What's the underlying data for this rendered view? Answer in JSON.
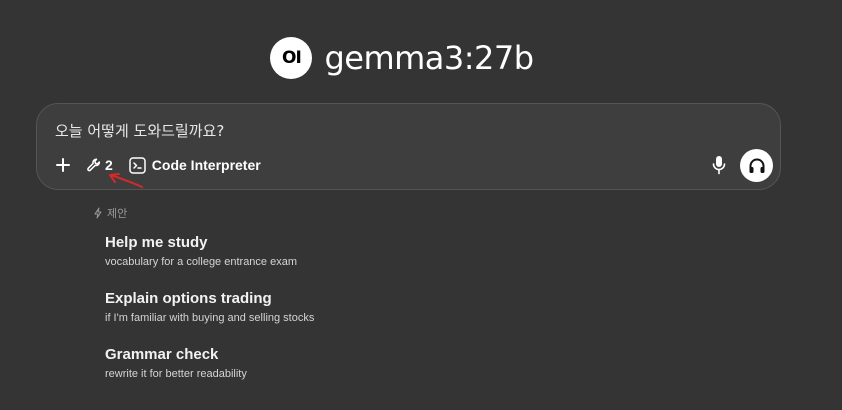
{
  "header": {
    "logo_text": "OI",
    "model_name": "gemma3:27b"
  },
  "chat": {
    "placeholder": "오늘 어떻게 도와드릴까요?",
    "plus_icon": "plus-icon",
    "tools_icon": "wrench-icon",
    "tools_count": "2",
    "code_icon": "terminal-icon",
    "code_label": "Code Interpreter",
    "mic_icon": "microphone-icon",
    "voice_icon": "headphones-icon"
  },
  "annotation": {
    "color": "#d42a2a"
  },
  "suggestions": {
    "icon": "bolt-icon",
    "label": "제안",
    "items": [
      {
        "title": "Help me study",
        "subtitle": "vocabulary for a college entrance exam"
      },
      {
        "title": "Explain options trading",
        "subtitle": "if I'm familiar with buying and selling stocks"
      },
      {
        "title": "Grammar check",
        "subtitle": "rewrite it for better readability"
      }
    ]
  },
  "colors": {
    "background": "#343434",
    "input_bg": "#3e3e3e",
    "text": "#ececec"
  }
}
